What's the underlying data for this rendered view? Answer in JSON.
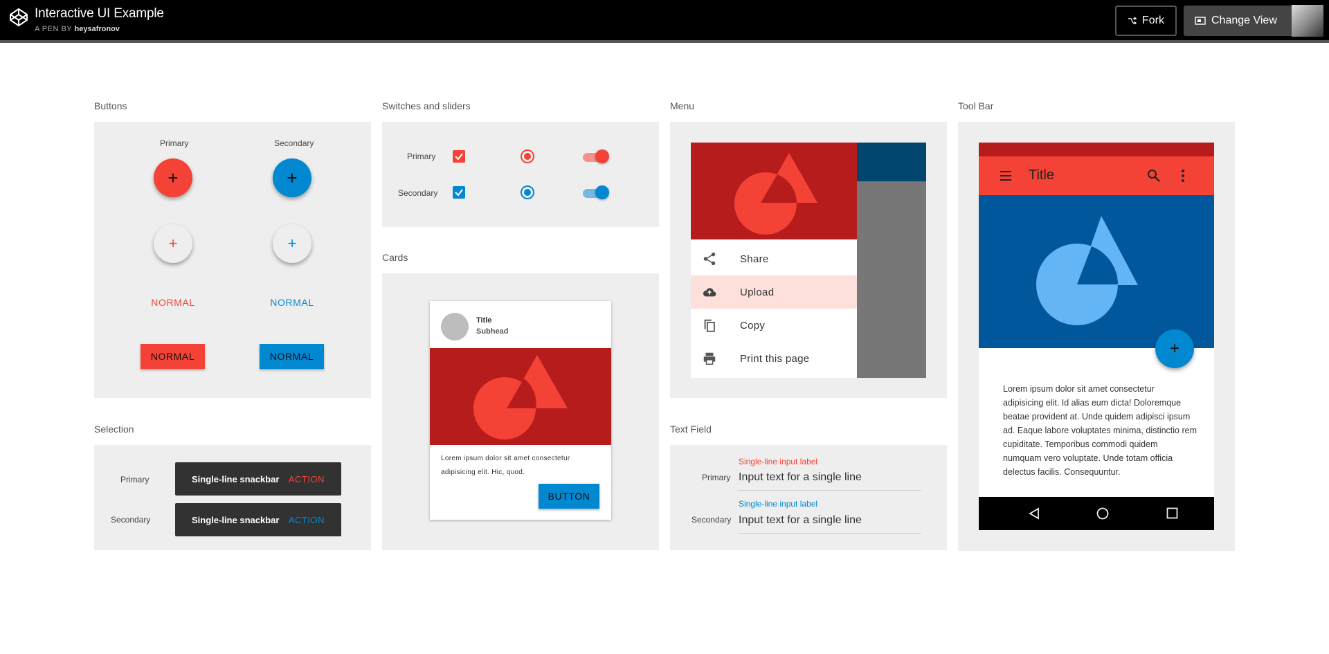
{
  "header": {
    "title": "Interactive UI Example",
    "byline_prefix": "A PEN BY",
    "author": "heysafronov",
    "fork_label": "Fork",
    "change_view_label": "Change View"
  },
  "colors": {
    "primary": "#f44336",
    "primary_dark": "#b71c1c",
    "secondary": "#0288d1",
    "secondary_dark": "#01579b",
    "panel_bg": "#eeeeee"
  },
  "buttons": {
    "title": "Buttons",
    "primary_label": "Primary",
    "secondary_label": "Secondary",
    "fab_icon": "+",
    "flat_label": "NORMAL",
    "raised_label": "NORMAL"
  },
  "switches": {
    "title": "Switches and sliders",
    "primary_label": "Primary",
    "secondary_label": "Secondary"
  },
  "selection": {
    "title": "Selection",
    "primary_label": "Primary",
    "secondary_label": "Secondary",
    "snackbar_text": "Single-line snackbar",
    "action_label": "ACTION"
  },
  "cards": {
    "title": "Cards",
    "card_title": "Title",
    "card_subhead": "Subhead",
    "body": "Lorem ipsum dolor sit amet consectetur adipisicing elit. Hic, quod.",
    "button_label": "BUTTON"
  },
  "menu": {
    "title": "Menu",
    "items": [
      {
        "label": "Share",
        "icon": "share-icon"
      },
      {
        "label": "Upload",
        "icon": "cloud-upload-icon"
      },
      {
        "label": "Copy",
        "icon": "copy-icon"
      },
      {
        "label": "Print this page",
        "icon": "print-icon"
      }
    ]
  },
  "text_field": {
    "title": "Text Field",
    "primary_label": "Primary",
    "secondary_label": "Secondary",
    "field_label": "Single-line input label",
    "field_value": "Input text for a single line"
  },
  "toolbar": {
    "title": "Tool Bar",
    "app_title": "Title",
    "fab_icon": "+",
    "body": "Lorem ipsum dolor sit amet consectetur adipisicing elit. Id alias eum dicta! Doloremque beatae provident at. Unde quidem adipisci ipsum ad. Eaque labore voluptates minima, distinctio rem cupiditate. Temporibus commodi quidem numquam vero voluptate. Unde totam officia delectus facilis. Consequuntur."
  }
}
